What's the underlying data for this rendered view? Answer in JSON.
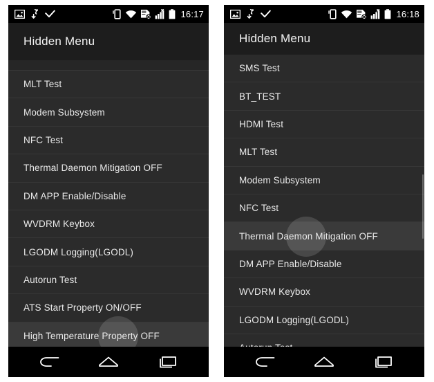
{
  "panels": [
    {
      "name": "left-screenshot",
      "statusbar": {
        "icons_left": [
          "image-icon",
          "download-icon",
          "check-icon"
        ],
        "icons_right": [
          "vibrate-icon",
          "wifi-icon",
          "sync-disabled-icon",
          "signal-icon",
          "battery-icon"
        ],
        "clock": "16:17"
      },
      "header": {
        "title": "Hidden Menu"
      },
      "has_header_gap": true,
      "items": [
        {
          "label": "MLT Test",
          "pressed": false
        },
        {
          "label": "Modem Subsystem",
          "pressed": false
        },
        {
          "label": "NFC Test",
          "pressed": false
        },
        {
          "label": "Thermal Daemon Mitigation OFF",
          "pressed": false
        },
        {
          "label": "DM APP Enable/Disable",
          "pressed": false
        },
        {
          "label": "WVDRM Keybox",
          "pressed": false
        },
        {
          "label": "LGODM Logging(LGODL)",
          "pressed": false
        },
        {
          "label": "Autorun Test",
          "pressed": false
        },
        {
          "label": "ATS Start Property ON/OFF",
          "pressed": false
        },
        {
          "label": "High Temperature Property OFF",
          "pressed": true
        }
      ],
      "scrollbar": null,
      "navbar": {
        "back": "back-icon",
        "home": "home-icon",
        "recents": "recents-icon"
      }
    },
    {
      "name": "right-screenshot",
      "statusbar": {
        "icons_left": [
          "image-icon",
          "download-icon",
          "check-icon"
        ],
        "icons_right": [
          "vibrate-icon",
          "wifi-icon",
          "sync-disabled-icon",
          "signal-icon",
          "battery-icon"
        ],
        "clock": "16:18"
      },
      "header": {
        "title": "Hidden Menu"
      },
      "has_header_gap": false,
      "items": [
        {
          "label": "SMS Test",
          "pressed": false
        },
        {
          "label": "BT_TEST",
          "pressed": false
        },
        {
          "label": "HDMI Test",
          "pressed": false
        },
        {
          "label": "MLT Test",
          "pressed": false
        },
        {
          "label": "Modem Subsystem",
          "pressed": false
        },
        {
          "label": "NFC Test",
          "pressed": false
        },
        {
          "label": "Thermal Daemon Mitigation OFF",
          "pressed": true
        },
        {
          "label": "DM APP Enable/Disable",
          "pressed": false
        },
        {
          "label": "WVDRM Keybox",
          "pressed": false
        },
        {
          "label": "LGODM Logging(LGODL)",
          "pressed": false
        },
        {
          "label": "Autorun Test",
          "pressed": false
        }
      ],
      "scrollbar": {
        "top_pct": 41,
        "height_pct": 22
      },
      "navbar": {
        "back": "back-icon",
        "home": "home-icon",
        "recents": "recents-icon"
      }
    }
  ],
  "colors": {
    "screen_bg": "#2b2b2b",
    "header_bg": "#1d1d1d",
    "statusbar_bg": "#000000",
    "navbar_bg": "#000000",
    "text": "#eaeaea",
    "divider": "#373737",
    "pressed_row": "#3a3a3a",
    "page_bg": "#ffffff"
  }
}
